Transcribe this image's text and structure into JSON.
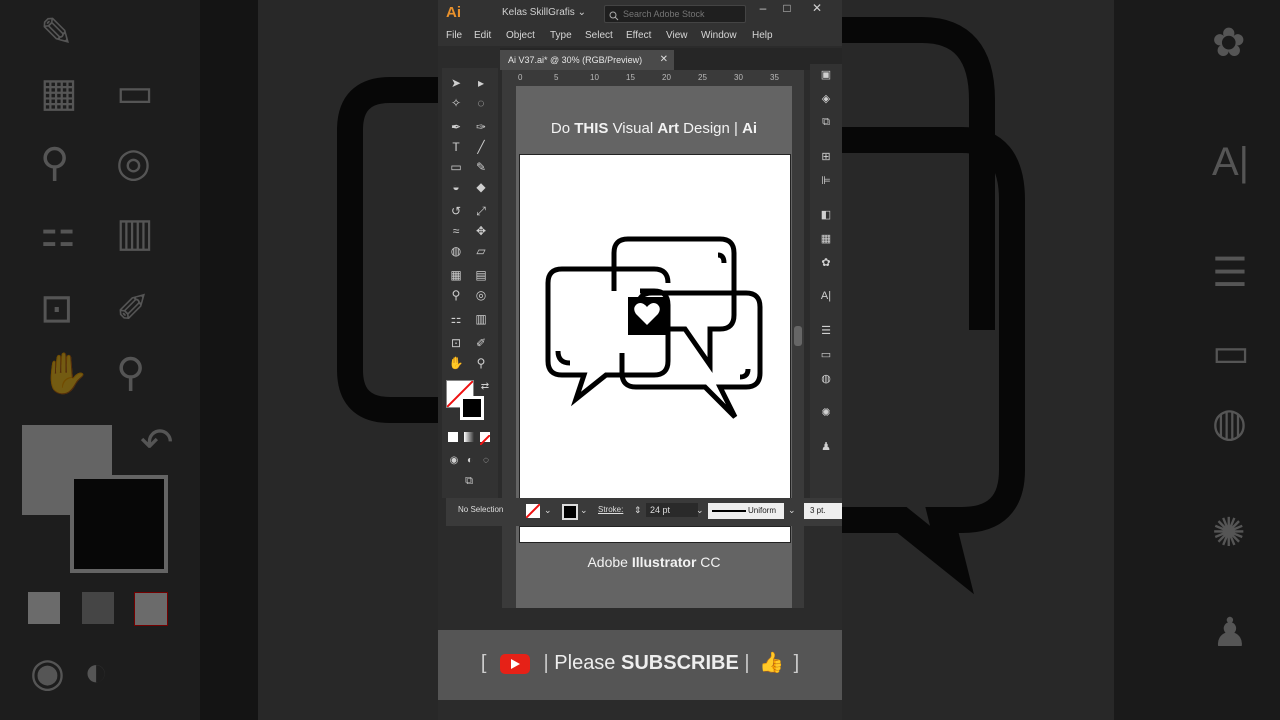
{
  "app": {
    "logo": "Ai",
    "workspace": "Kelas SkillGrafis",
    "stock_placeholder": "Search Adobe Stock",
    "window_buttons": [
      "–",
      "□",
      "✕"
    ]
  },
  "menu": [
    "File",
    "Edit",
    "Object",
    "Type",
    "Select",
    "Effect",
    "View",
    "Window",
    "Help"
  ],
  "document_tab": {
    "title": "Ai V37.ai* @ 30% (RGB/Preview)",
    "close": "✕"
  },
  "ruler_ticks": [
    "0",
    "5",
    "10",
    "15",
    "20",
    "25",
    "30",
    "35"
  ],
  "overlay": {
    "headline_parts": [
      "Do ",
      "THIS",
      " Visual ",
      "Art",
      " Design | ",
      "Ai"
    ],
    "footer_parts": [
      "Adobe ",
      "Illustrator",
      " CC"
    ]
  },
  "control_bar": {
    "selection": "No Selection",
    "stroke_label": "Stroke:",
    "stroke_value": "24 pt",
    "profile": "Uniform",
    "brush": "3 pt."
  },
  "banner": {
    "open": "[",
    "close": "]",
    "sep": "|",
    "please": "Please",
    "subscribe": "SUBSCRIBE"
  },
  "colors": {
    "accent": "#e8912c",
    "youtube": "#e62117"
  },
  "icons": [
    "selection-tool-icon",
    "direct-selection-icon",
    "magic-wand-icon",
    "lasso-icon",
    "pen-icon",
    "curvature-icon",
    "type-icon",
    "line-icon",
    "rectangle-icon",
    "paintbrush-icon",
    "shaper-icon",
    "eraser-icon",
    "rotate-icon",
    "scale-icon",
    "width-icon",
    "puppet-warp-icon",
    "shape-builder-icon",
    "perspective-icon",
    "mesh-icon",
    "gradient-icon",
    "eyedropper-icon",
    "blend-icon",
    "symbol-sprayer-icon",
    "graph-icon",
    "artboard-icon",
    "slice-icon",
    "hand-icon",
    "zoom-icon",
    "youtube-icon",
    "thumbs-up-icon"
  ]
}
